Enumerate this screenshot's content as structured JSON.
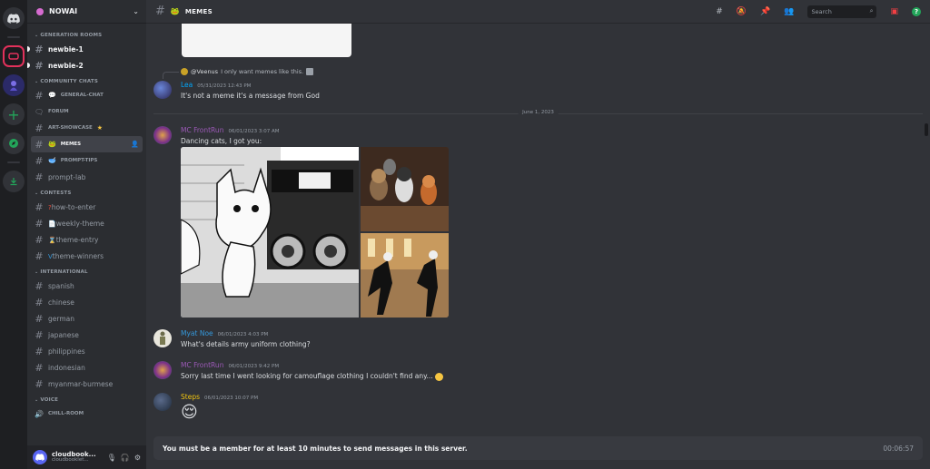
{
  "server": {
    "name": "NOWAI"
  },
  "categories": {
    "generation": "GENERATION ROOMS",
    "community": "COMMUNITY CHATS",
    "contests": "CONTESTS",
    "international": "INTERNATIONAL",
    "voice": "VOICE"
  },
  "channels": {
    "newbie1": "newbie-1",
    "newbie2": "newbie-2",
    "general": "GENERAL-CHAT",
    "forum": "FORUM",
    "art": "ART-SHOWCASE",
    "memes": "MEMES",
    "prompt_tips": "PROMPT-TIPS",
    "prompt_lab": "prompt-lab",
    "how_to_enter": "how-to-enter",
    "weekly_theme": "weekly-theme",
    "theme_entry": "theme-entry",
    "theme_winners": "theme-winners",
    "spanish": "spanish",
    "chinese": "chinese",
    "german": "german",
    "japanese": "japanese",
    "philippines": "philippines",
    "indonesian": "indonesian",
    "myanmar": "myanmar-burmese",
    "chill": "CHILL-ROOM"
  },
  "user": {
    "name": "cloudbook...",
    "tag": "cloudbooklet..."
  },
  "topbar": {
    "channel": "MEMES",
    "search_placeholder": "Search"
  },
  "reply": {
    "name": "@Veenus",
    "text": "I only want memes like this."
  },
  "messages": [
    {
      "author": "Lea",
      "time": "05/31/2023 12:43 PM",
      "text": "It's not a meme it's a message from God",
      "color": "#00a8fc"
    },
    {
      "author": "MC FrontRun",
      "time": "06/01/2023 3:07 AM",
      "text": "Dancing cats, I got you:",
      "color": "#9b59b6"
    },
    {
      "author": "Myat Noe",
      "time": "06/01/2023 4:03 PM",
      "text": "What's details army uniform clothing?",
      "color": "#3498db"
    },
    {
      "author": "MC FrontRun",
      "time": "06/01/2023 9:42 PM",
      "text": "Sorry last time I went looking for camouflage clothing I couldn't find any...",
      "color": "#9b59b6"
    },
    {
      "author": "Steps",
      "time": "06/01/2023 10:07 PM",
      "text": "",
      "color": "#f1c40f"
    }
  ],
  "divider": "June 1, 2023",
  "composer": {
    "notice": "You must be a member for at least 10 minutes to send messages in this server.",
    "timer": "00:06:57"
  },
  "icons": {
    "discord": "discord-logo-icon",
    "emoji_relieved": "😌"
  }
}
